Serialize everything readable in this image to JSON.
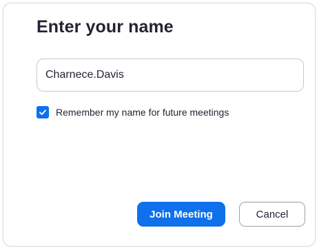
{
  "dialog": {
    "title": "Enter your name",
    "name_input": {
      "value": "Charnece.Davis",
      "placeholder": ""
    },
    "remember": {
      "checked": true,
      "label": "Remember my name for future meetings"
    },
    "buttons": {
      "join_label": "Join Meeting",
      "cancel_label": "Cancel"
    }
  },
  "colors": {
    "accent": "#0e71eb",
    "text": "#232333",
    "border": "#c9c9cf"
  },
  "icons": {
    "checkbox": "checkmark-icon"
  }
}
